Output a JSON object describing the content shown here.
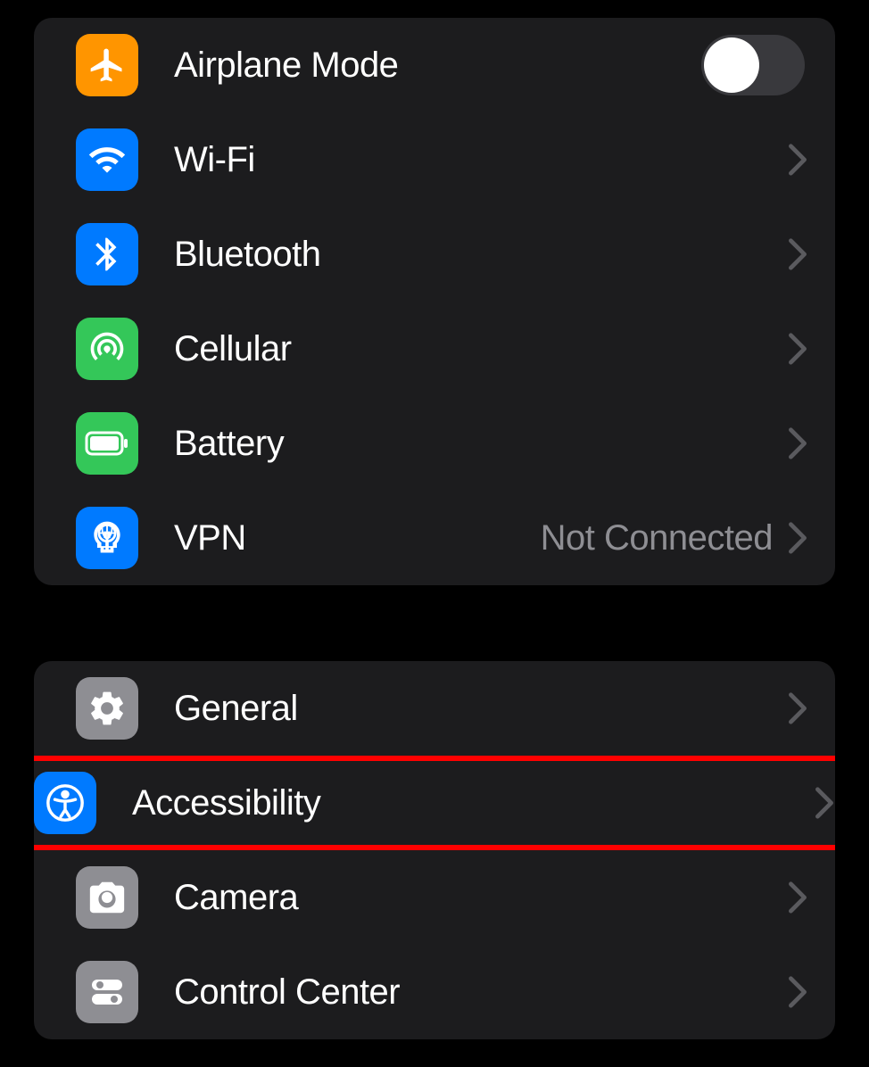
{
  "group1": {
    "airplane": {
      "label": "Airplane Mode",
      "toggled": false
    },
    "wifi": {
      "label": "Wi-Fi"
    },
    "bluetooth": {
      "label": "Bluetooth"
    },
    "cellular": {
      "label": "Cellular"
    },
    "battery": {
      "label": "Battery"
    },
    "vpn": {
      "label": "VPN",
      "value": "Not Connected"
    }
  },
  "group2": {
    "general": {
      "label": "General"
    },
    "accessibility": {
      "label": "Accessibility",
      "highlighted": true
    },
    "camera": {
      "label": "Camera"
    },
    "control_center": {
      "label": "Control Center"
    }
  },
  "icons": {
    "airplane": "airplane-icon",
    "wifi": "wifi-icon",
    "bluetooth": "bluetooth-icon",
    "cellular": "cellular-icon",
    "battery": "battery-icon",
    "vpn": "vpn-icon",
    "general": "gear-icon",
    "accessibility": "accessibility-icon",
    "camera": "camera-icon",
    "control_center": "control-center-icon"
  },
  "colors": {
    "orange": "#ff9500",
    "blue": "#007aff",
    "green": "#34c759",
    "gray": "#8e8e93",
    "highlight": "#ff0000"
  }
}
